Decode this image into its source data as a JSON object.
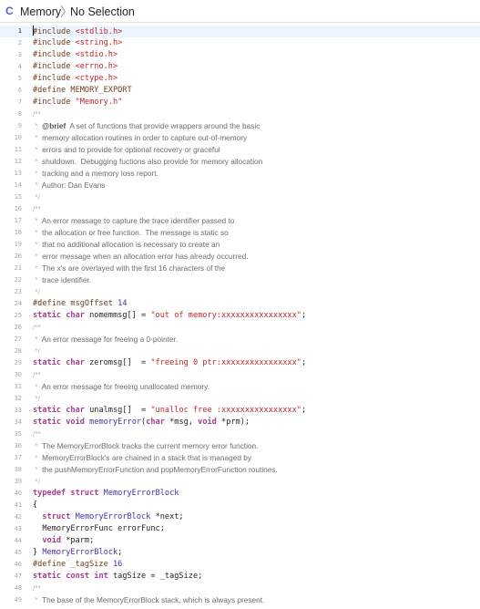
{
  "breadcrumb": {
    "file_icon": "C",
    "file": "Memory",
    "chevron": "〉",
    "selection": "No Selection"
  },
  "editor": {
    "current_line": 1,
    "lines": [
      {
        "n": "1",
        "parts": [
          [
            "pp",
            "#include "
          ],
          [
            "str",
            "<stdlib.h>"
          ]
        ]
      },
      {
        "n": "2",
        "parts": [
          [
            "pp",
            "#include "
          ],
          [
            "str",
            "<string.h>"
          ]
        ]
      },
      {
        "n": "3",
        "parts": [
          [
            "pp",
            "#include "
          ],
          [
            "str",
            "<stdio.h>"
          ]
        ]
      },
      {
        "n": "4",
        "parts": [
          [
            "pp",
            "#include "
          ],
          [
            "str",
            "<errno.h>"
          ]
        ]
      },
      {
        "n": "5",
        "parts": [
          [
            "pp",
            "#include "
          ],
          [
            "str",
            "<ctype.h>"
          ]
        ]
      },
      {
        "n": "6",
        "parts": [
          [
            "pp",
            "#define MEMORY_EXPORT"
          ]
        ]
      },
      {
        "n": "7",
        "parts": [
          [
            "pp",
            "#include "
          ],
          [
            "str",
            "\"Memory.h\""
          ]
        ]
      },
      {
        "n": "8",
        "comment": true,
        "parts": [
          [
            "mk",
            "/**"
          ]
        ]
      },
      {
        "n": "9",
        "comment": true,
        "parts": [
          [
            "mk",
            " *  "
          ],
          [
            "cw",
            "@brief"
          ],
          [
            "",
            "  A set of functions that provide wrappers around the basic"
          ]
        ]
      },
      {
        "n": "10",
        "comment": true,
        "parts": [
          [
            "mk",
            " *  "
          ],
          [
            "",
            "memory allocation routines in order to capture out-of-memory"
          ]
        ]
      },
      {
        "n": "11",
        "comment": true,
        "parts": [
          [
            "mk",
            " *  "
          ],
          [
            "",
            "errors and to provide for optional recovery or graceful"
          ]
        ]
      },
      {
        "n": "12",
        "comment": true,
        "parts": [
          [
            "mk",
            " *  "
          ],
          [
            "",
            "shutdown.  Debugging fuctions also provide for memory allocation"
          ]
        ]
      },
      {
        "n": "13",
        "comment": true,
        "parts": [
          [
            "mk",
            " *  "
          ],
          [
            "",
            "tracking and a memory loss report."
          ]
        ]
      },
      {
        "n": "14",
        "comment": true,
        "parts": [
          [
            "mk",
            " *  "
          ],
          [
            "",
            "Author: Dan Evans"
          ]
        ]
      },
      {
        "n": "15",
        "comment": true,
        "parts": [
          [
            "mk",
            " */"
          ]
        ]
      },
      {
        "n": "16",
        "comment": true,
        "parts": [
          [
            "mk",
            "/**"
          ]
        ]
      },
      {
        "n": "17",
        "comment": true,
        "parts": [
          [
            "mk",
            " *  "
          ],
          [
            "",
            "An error message to capture the trace identifier passed to"
          ]
        ]
      },
      {
        "n": "18",
        "comment": true,
        "parts": [
          [
            "mk",
            " *  "
          ],
          [
            "",
            "the allocation or free function.  The message is static so"
          ]
        ]
      },
      {
        "n": "19",
        "comment": true,
        "parts": [
          [
            "mk",
            " *  "
          ],
          [
            "",
            "that no additional allocation is necessary to create an"
          ]
        ]
      },
      {
        "n": "20",
        "comment": true,
        "parts": [
          [
            "mk",
            " *  "
          ],
          [
            "",
            "error message when an allocation error has already occurred."
          ]
        ]
      },
      {
        "n": "21",
        "comment": true,
        "parts": [
          [
            "mk",
            " *  "
          ],
          [
            "",
            "The x's are overlayed with the first 16 characters of the"
          ]
        ]
      },
      {
        "n": "22",
        "comment": true,
        "parts": [
          [
            "mk",
            " *  "
          ],
          [
            "",
            "trace identifier."
          ]
        ]
      },
      {
        "n": "23",
        "comment": true,
        "parts": [
          [
            "mk",
            " */"
          ]
        ]
      },
      {
        "n": "24",
        "parts": [
          [
            "pp",
            "#define msgOffset "
          ],
          [
            "ty",
            "14"
          ]
        ]
      },
      {
        "n": "25",
        "parts": [
          [
            "kw",
            "static"
          ],
          [
            "",
            " "
          ],
          [
            "kw",
            "char"
          ],
          [
            "",
            " nomemmsg[] = "
          ],
          [
            "str",
            "\"out of memory:xxxxxxxxxxxxxxxx\""
          ],
          [
            "",
            ";"
          ]
        ]
      },
      {
        "n": "26",
        "comment": true,
        "parts": [
          [
            "mk",
            "/**"
          ]
        ]
      },
      {
        "n": "27",
        "comment": true,
        "parts": [
          [
            "mk",
            " *  "
          ],
          [
            "",
            "An error message for freeing a 0-pointer."
          ]
        ]
      },
      {
        "n": "28",
        "comment": true,
        "parts": [
          [
            "mk",
            " */"
          ]
        ]
      },
      {
        "n": "29",
        "parts": [
          [
            "kw",
            "static"
          ],
          [
            "",
            " "
          ],
          [
            "kw",
            "char"
          ],
          [
            "",
            " zeromsg[]  = "
          ],
          [
            "str",
            "\"freeing 0 ptr:xxxxxxxxxxxxxxxx\""
          ],
          [
            "",
            ";"
          ]
        ]
      },
      {
        "n": "30",
        "comment": true,
        "parts": [
          [
            "mk",
            "/**"
          ]
        ]
      },
      {
        "n": "31",
        "comment": true,
        "parts": [
          [
            "mk",
            " *  "
          ],
          [
            "",
            "An error message for freeing unallocated memory."
          ]
        ]
      },
      {
        "n": "32",
        "comment": true,
        "parts": [
          [
            "mk",
            " */"
          ]
        ]
      },
      {
        "n": "33",
        "parts": [
          [
            "kw",
            "static"
          ],
          [
            "",
            " "
          ],
          [
            "kw",
            "char"
          ],
          [
            "",
            " unalmsg[]  = "
          ],
          [
            "str",
            "\"unalloc free :xxxxxxxxxxxxxxxx\""
          ],
          [
            "",
            ";"
          ]
        ]
      },
      {
        "n": "34",
        "parts": [
          [
            "kw",
            "static"
          ],
          [
            "",
            " "
          ],
          [
            "kw",
            "void"
          ],
          [
            "",
            " "
          ],
          [
            "ty",
            "memoryError"
          ],
          [
            "",
            "("
          ],
          [
            "kw",
            "char"
          ],
          [
            "",
            " *msg, "
          ],
          [
            "kw",
            "void"
          ],
          [
            "",
            " *prm);"
          ]
        ]
      },
      {
        "n": "35",
        "comment": true,
        "parts": [
          [
            "mk",
            "/**"
          ]
        ]
      },
      {
        "n": "36",
        "comment": true,
        "parts": [
          [
            "mk",
            " *  "
          ],
          [
            "",
            "The MemoryErrorBlock tracks the current memory error function."
          ]
        ]
      },
      {
        "n": "37",
        "comment": true,
        "parts": [
          [
            "mk",
            " *  "
          ],
          [
            "",
            "MemoryErrorBlock's are chained in a stack that is managed by"
          ]
        ]
      },
      {
        "n": "38",
        "comment": true,
        "parts": [
          [
            "mk",
            " *  "
          ],
          [
            "",
            "the pushMemoryErrorFunction and popMemoryErrorFunction routines."
          ]
        ]
      },
      {
        "n": "39",
        "comment": true,
        "parts": [
          [
            "mk",
            " */"
          ]
        ]
      },
      {
        "n": "40",
        "parts": [
          [
            "kw",
            "typedef"
          ],
          [
            "",
            " "
          ],
          [
            "kw",
            "struct"
          ],
          [
            "",
            " "
          ],
          [
            "ty",
            "MemoryErrorBlock"
          ]
        ]
      },
      {
        "n": "41",
        "parts": [
          [
            "",
            "{"
          ]
        ]
      },
      {
        "n": "42",
        "parts": [
          [
            "",
            "  "
          ],
          [
            "kw",
            "struct"
          ],
          [
            "",
            " "
          ],
          [
            "ty",
            "MemoryErrorBlock"
          ],
          [
            "",
            " *next;"
          ]
        ]
      },
      {
        "n": "43",
        "parts": [
          [
            "",
            "  MemoryErrorFunc errorFunc;"
          ]
        ]
      },
      {
        "n": "44",
        "parts": [
          [
            "",
            "  "
          ],
          [
            "kw",
            "void"
          ],
          [
            "",
            " *parm;"
          ]
        ]
      },
      {
        "n": "45",
        "parts": [
          [
            "",
            "} "
          ],
          [
            "ty",
            "MemoryErrorBlock"
          ],
          [
            "",
            ";"
          ]
        ]
      },
      {
        "n": "46",
        "parts": [
          [
            "pp",
            "#define _tagSize "
          ],
          [
            "ty",
            "16"
          ]
        ]
      },
      {
        "n": "47",
        "parts": [
          [
            "kw",
            "static"
          ],
          [
            "",
            " "
          ],
          [
            "kw",
            "const"
          ],
          [
            "",
            " "
          ],
          [
            "kw",
            "int"
          ],
          [
            "",
            " tagSize = _tagSize;"
          ]
        ]
      },
      {
        "n": "48",
        "comment": true,
        "parts": [
          [
            "mk",
            "/**"
          ]
        ]
      },
      {
        "n": "49",
        "comment": true,
        "parts": [
          [
            "mk",
            " *  "
          ],
          [
            "",
            "The base of the MemoryErrorBlock stack, which is always present."
          ]
        ]
      }
    ]
  }
}
